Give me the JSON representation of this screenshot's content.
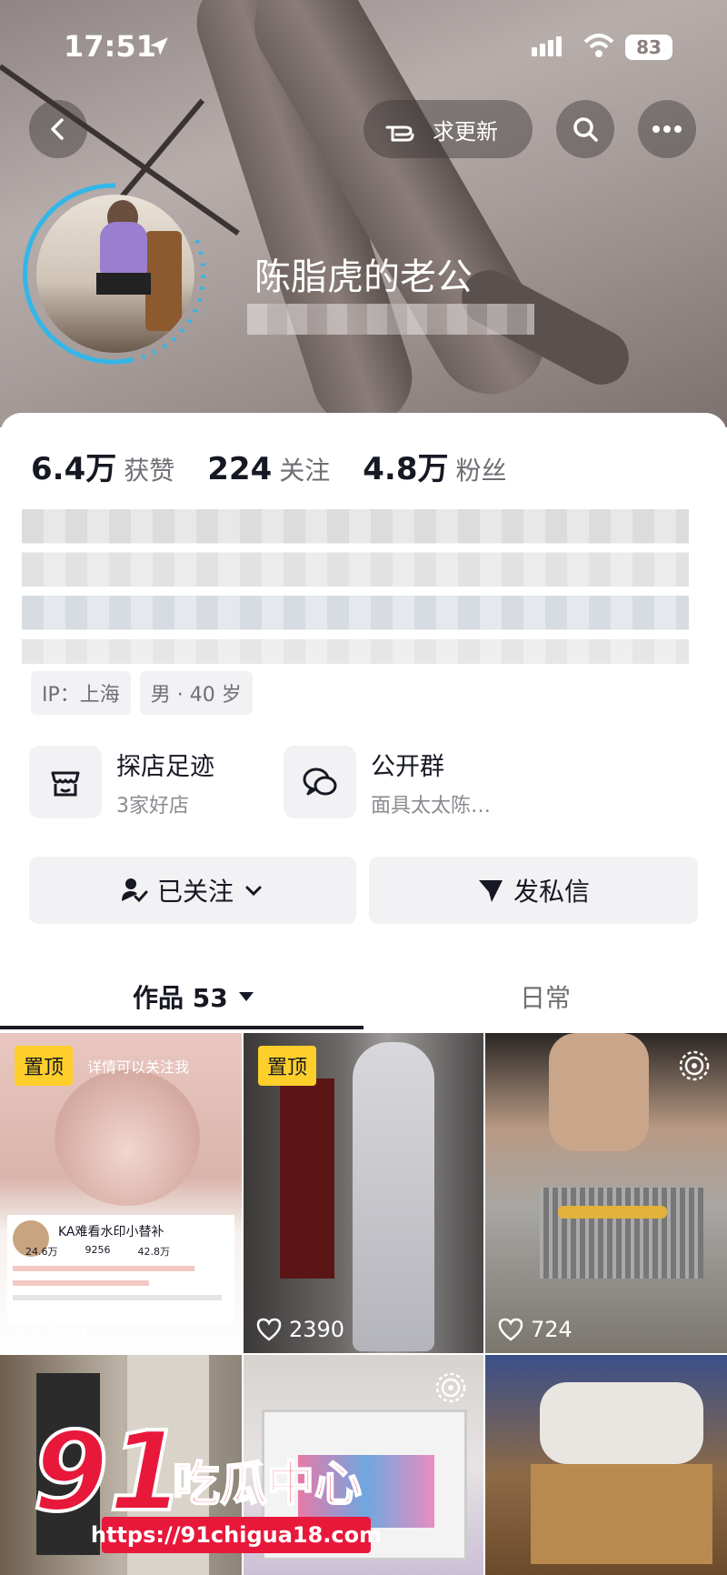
{
  "status_bar": {
    "time": "17:51",
    "battery": "83"
  },
  "header": {
    "request_update_label": "求更新",
    "username": "陈脂虎的老公"
  },
  "stats": [
    {
      "value": "6.4万",
      "label": "获赞"
    },
    {
      "value": "224",
      "label": "关注"
    },
    {
      "value": "4.8万",
      "label": "粉丝"
    }
  ],
  "tags": [
    "IP：上海",
    "男 · 40 岁"
  ],
  "features": [
    {
      "title": "探店足迹",
      "subtitle": "3家好店",
      "icon": "shop-icon"
    },
    {
      "title": "公开群",
      "subtitle": "面具太太陈…",
      "icon": "group-chat-icon"
    }
  ],
  "actions": {
    "follow_label": "已关注",
    "message_label": "发私信"
  },
  "tabs": [
    {
      "label": "作品 53"
    },
    {
      "label": "日常"
    }
  ],
  "videos": [
    {
      "pinned": "置顶",
      "likes": "535",
      "overlay_text": "详情可以关注我",
      "card_name": "KA难看水印小替补",
      "card_stats": [
        "24.6万",
        "9256",
        "42.8万"
      ]
    },
    {
      "pinned": "置顶",
      "likes": "2390"
    },
    {
      "likes": "724"
    },
    {},
    {},
    {}
  ],
  "watermark": {
    "big": "91",
    "text": "吃瓜中心",
    "url": "https://91chigua18.com"
  },
  "colors": {
    "accent_red": "#e8183b",
    "pin_yellow": "#fecf2b",
    "text_primary": "#161823"
  }
}
